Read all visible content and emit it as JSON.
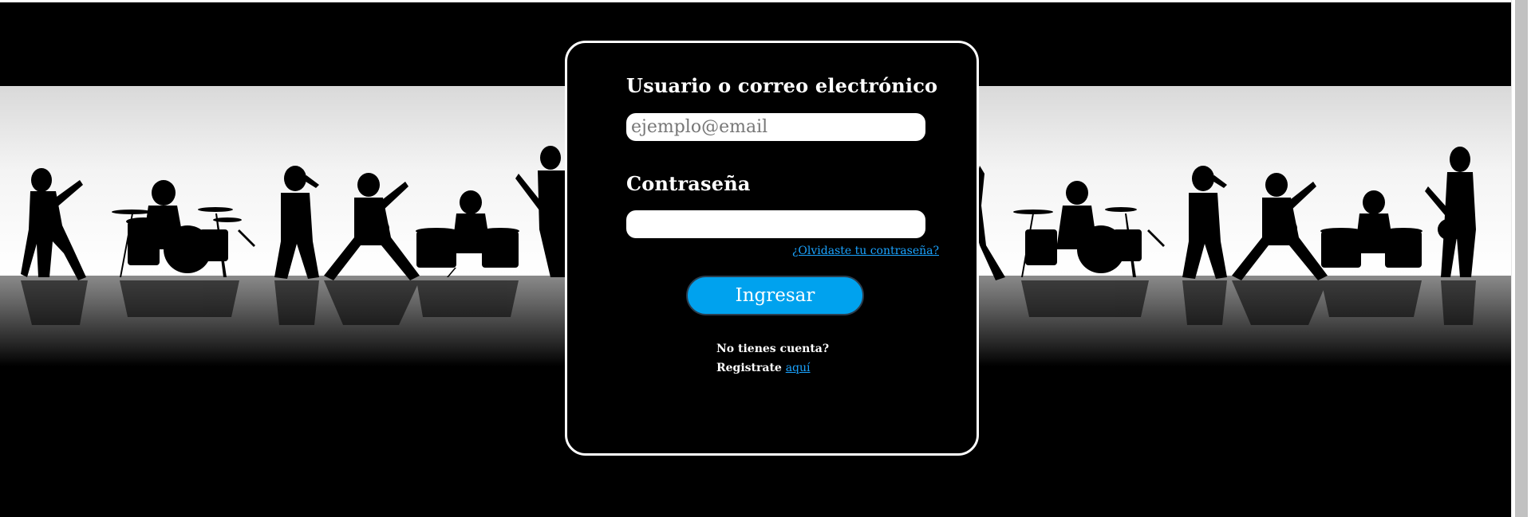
{
  "login": {
    "user_label": "Usuario o correo electrónico",
    "user_placeholder": "ejemplo@email",
    "user_value": "",
    "password_label": "Contraseña",
    "password_value": "",
    "forgot_link": "¿Olvidaste tu contraseña?",
    "submit_label": "Ingresar",
    "no_account_text": "No tienes cuenta?",
    "register_prefix": "Registrate",
    "register_link": "aquí"
  },
  "colors": {
    "page_background": "#000000",
    "card_border": "#ffffff",
    "accent_button": "#00a2ee",
    "link": "#1aa3ff"
  },
  "banner": {
    "image": "rock-band-silhouettes"
  }
}
